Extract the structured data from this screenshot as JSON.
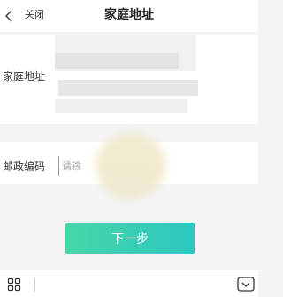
{
  "header": {
    "back_icon": "chevron-left-icon",
    "close_label": "关闭",
    "title": "家庭地址"
  },
  "form": {
    "address_label": "家庭地址",
    "postcode_label": "邮政编码",
    "postcode_placeholder": "请输",
    "postcode_value": ""
  },
  "actions": {
    "next_label": "下一步"
  },
  "bottom_bar": {
    "left_icon": "grid-icon",
    "right_icon": "keyboard-toggle-icon"
  },
  "colors": {
    "button_gradient_start": "#46d7a7",
    "button_gradient_end": "#2cc7c1",
    "background": "#f4f4f4"
  }
}
